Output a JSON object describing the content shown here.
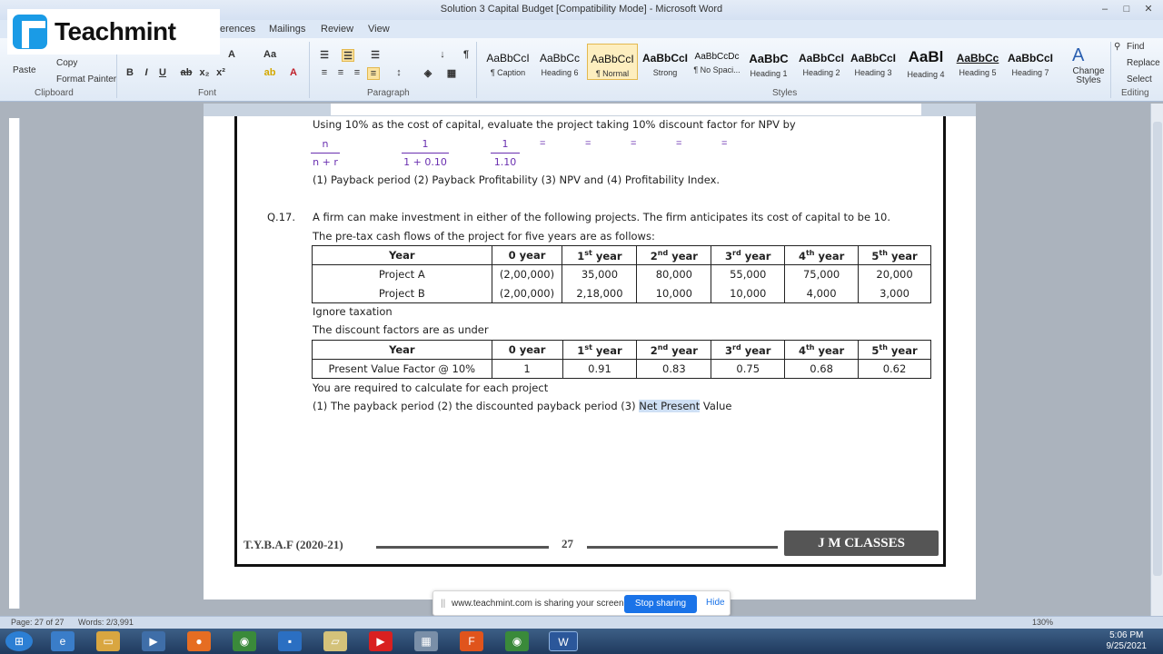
{
  "window": {
    "title": "Solution 3 Capital Budget [Compatibility Mode] - Microsoft Word",
    "buttons": [
      "–",
      "□",
      "✕"
    ]
  },
  "tabs": [
    "erences",
    "Mailings",
    "Review",
    "View"
  ],
  "overlay": {
    "brand": "Teachmint"
  },
  "ribbon": {
    "clipboard": {
      "paste": "Paste",
      "copy": "Copy",
      "format_painter": "Format Painter",
      "label": "Clipboard"
    },
    "font": {
      "label": "Font"
    },
    "paragraph": {
      "label": "Paragraph"
    },
    "styles": {
      "label": "Styles",
      "items": [
        {
          "preview": "AaBbCcI",
          "name": "¶ Caption"
        },
        {
          "preview": "AaBbCc",
          "name": "Heading 6"
        },
        {
          "preview": "AaBbCcI",
          "name": "¶ Normal"
        },
        {
          "preview": "AaBbCcI",
          "name": "Strong"
        },
        {
          "preview": "AaBbCcDc",
          "name": "¶ No Spaci..."
        },
        {
          "preview": "AaBbC",
          "name": "Heading 1"
        },
        {
          "preview": "AaBbCcI",
          "name": "Heading 2"
        },
        {
          "preview": "AaBbCcI",
          "name": "Heading 3"
        },
        {
          "preview": "AaBl",
          "name": "Heading 4"
        },
        {
          "preview": "AaBbCc",
          "name": "Heading 5"
        },
        {
          "preview": "AaBbCcI",
          "name": "Heading 7"
        }
      ],
      "change_styles": "Change Styles"
    },
    "editing": {
      "label": "Editing",
      "find": "Find",
      "replace": "Replace",
      "select": "Select"
    }
  },
  "document": {
    "intro_line": "Using 10% as the cost of capital, evaluate the project taking 10% discount factor for NPV by",
    "fractions": [
      {
        "num": "n",
        "den": "n + r"
      },
      {
        "num": "1",
        "den": "1 + 0.10"
      },
      {
        "num": "1",
        "den": "1.10"
      }
    ],
    "equals": "=",
    "task_line": "(1)  Payback period (2) Payback Profitability (3) NPV and (4) Profitability Index.",
    "q_number": "Q.17.",
    "q_line1": "A firm can make investment in either of the following projects. The firm anticipates its cost of capital to be 10.",
    "q_line2": "The pre-tax cash flows of the project for five years are as follows:",
    "table1": {
      "headers": [
        "Year",
        "0 year",
        "1",
        "st",
        " year",
        "2",
        "nd",
        " year",
        "3",
        "rd",
        " year",
        "4",
        "th",
        " year",
        "5",
        "th",
        " year"
      ],
      "rows": [
        [
          "Project A",
          "(2,00,000)",
          "35,000",
          "80,000",
          "55,000",
          "75,000",
          "20,000"
        ],
        [
          "Project B",
          "(2,00,000)",
          "2,18,000",
          "10,000",
          "10,000",
          "4,000",
          "3,000"
        ]
      ]
    },
    "ignore_tax": "Ignore taxation",
    "discount_intro": "The discount factors are as under",
    "table2": {
      "row": [
        "Present Value Factor @ 10%",
        "1",
        "0.91",
        "0.83",
        "0.75",
        "0.68",
        "0.62"
      ]
    },
    "required": "You are required to calculate for each project",
    "final_prefix": "(1)  The payback period (2) the discounted payback period (3) ",
    "final_highlight": "Net Present",
    "final_suffix": " Value",
    "footer": {
      "left": "T.Y.B.A.F (2020-21)",
      "page": "27",
      "brand": "J M CLASSES"
    }
  },
  "sharebar": {
    "grip": "||",
    "message": "www.teachmint.com is sharing your screen.",
    "stop": "Stop sharing",
    "hide": "Hide"
  },
  "status": {
    "page": "Page: 27 of 27",
    "words": "Words: 2/3,991",
    "zoom": "130%"
  },
  "taskbar": {
    "time": "5:06 PM",
    "date": "9/25/2021"
  }
}
